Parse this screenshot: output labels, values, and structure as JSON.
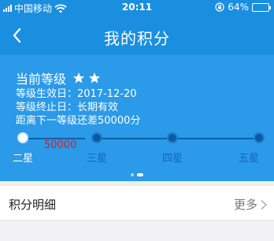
{
  "status_bar": {
    "carrier": "中国移动",
    "time": "20:11",
    "battery": "64%",
    "battery_level": 0.64
  },
  "nav": {
    "title": "我的积分",
    "back_icon": "chevron-left-icon"
  },
  "level": {
    "label": "当前等级",
    "stars": 2,
    "effective_date": "等级生效日：2017-12-20",
    "expiry_date": "等级终止日：长期有效",
    "gap_text": "距离下一等级还差50000分"
  },
  "progress": {
    "points": "50000",
    "tiers": [
      {
        "label": "二星",
        "current": true
      },
      {
        "label": "三星",
        "current": false
      },
      {
        "label": "四星",
        "current": false
      },
      {
        "label": "五星",
        "current": false
      }
    ]
  },
  "carousel": {
    "pages": 2,
    "active_page": 2
  },
  "detail": {
    "title": "积分明细",
    "more": "更多"
  },
  "colors": {
    "primary": "#1a8fe0",
    "banner": "#2b9ae8",
    "points_red": "#d0202a"
  }
}
